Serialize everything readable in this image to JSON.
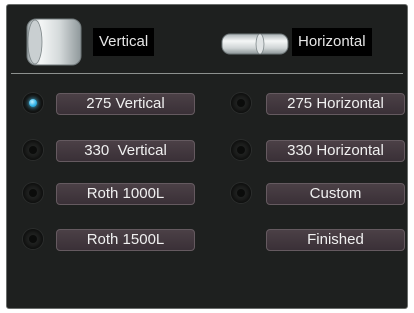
{
  "header": {
    "vertical_label": "Vertical",
    "horizontal_label": "Horizontal",
    "vertical_icon": "vertical-tank-icon",
    "horizontal_icon": "horizontal-tank-icon"
  },
  "options": {
    "left": [
      {
        "label": "275 Vertical",
        "selected": true
      },
      {
        "label": "330  Vertical",
        "selected": false
      },
      {
        "label": "Roth 1000L",
        "selected": false
      },
      {
        "label": "Roth 1500L",
        "selected": false
      }
    ],
    "right": [
      {
        "label": "275 Horizontal",
        "selected": false
      },
      {
        "label": "330 Horizontal",
        "selected": false
      },
      {
        "label": "Custom",
        "selected": false
      }
    ]
  },
  "actions": {
    "finished_label": "Finished"
  },
  "colors": {
    "panel_background": "#1e201f",
    "button_background": "#433840",
    "selected_indicator": "#34b6ea",
    "label_background": "#000000"
  }
}
